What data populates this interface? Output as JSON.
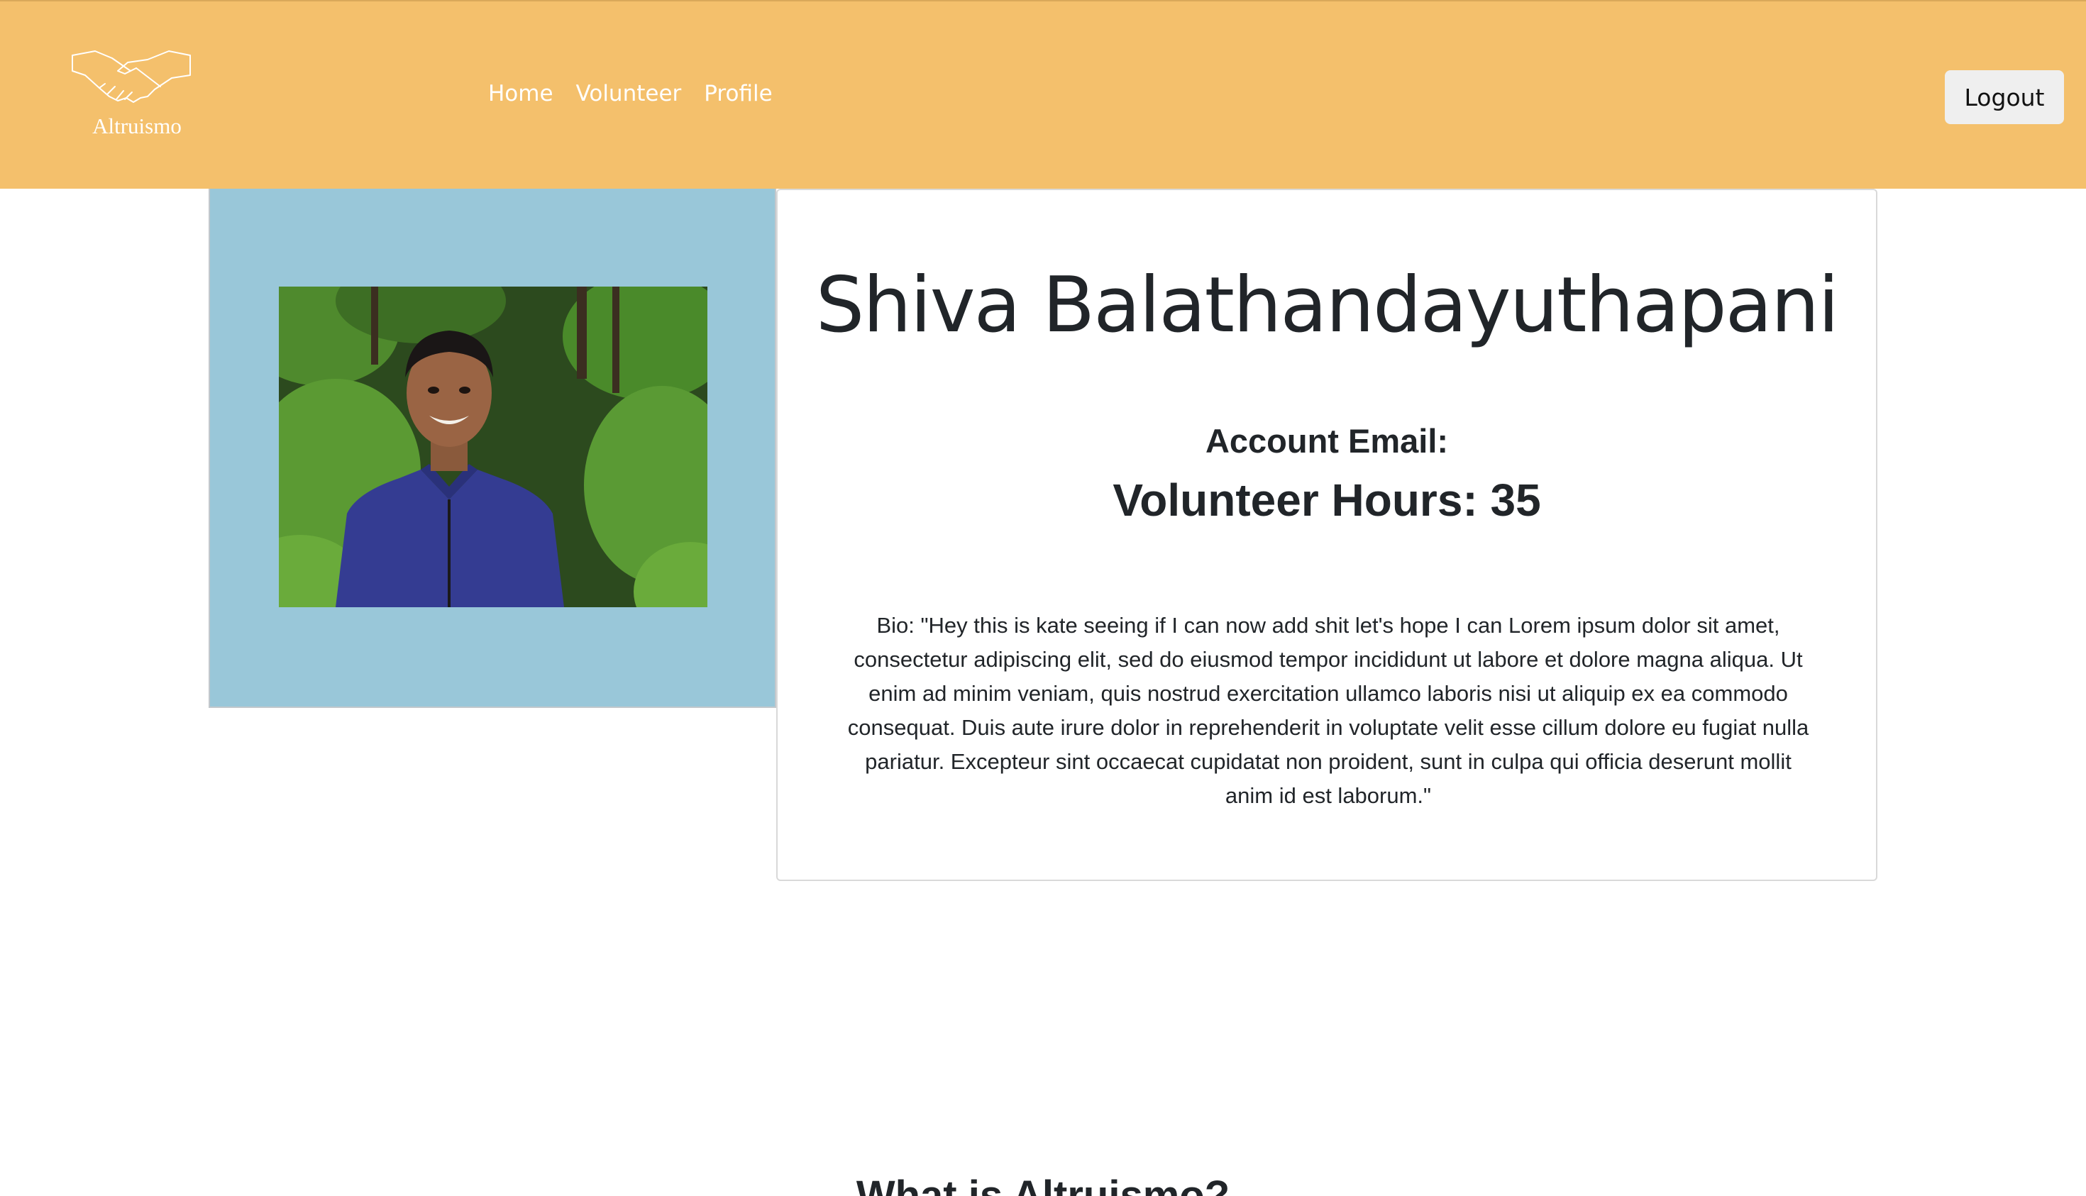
{
  "navbar": {
    "brand_name": "Altruismo",
    "logo_icon": "handshake-icon",
    "links": [
      "Home",
      "Volunteer",
      "Profile"
    ],
    "logout_label": "Logout",
    "background_color": "#f4c06c"
  },
  "profile": {
    "name": "Shiva Balathandayuthapani",
    "email_label": "Account Email:",
    "hours_line": "Volunteer Hours: 35",
    "bio": "Bio: \"Hey this is kate seeing if I can now add shit let's hope I can Lorem ipsum dolor sit amet, consectetur adipiscing elit, sed do eiusmod tempor incididunt ut labore et dolore magna aliqua. Ut enim ad minim veniam, quis nostrud exercitation ullamco laboris nisi ut aliquip ex ea commodo consequat. Duis aute irure dolor in reprehenderit in voluptate velit esse cillum dolore eu fugiat nulla pariatur. Excepteur sint occaecat cupidatat non proident, sunt in culpa qui officia deserunt mollit anim id est laborum.\"",
    "photo_panel_color": "#99c7d9"
  },
  "about": {
    "heading": "What is Altruismo?"
  }
}
